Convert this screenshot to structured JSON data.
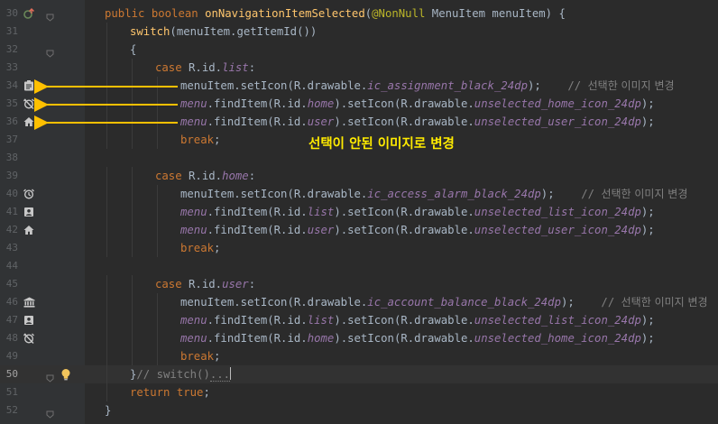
{
  "editor": {
    "annotation": "선택이 안된 이미지로 변경",
    "lines": [
      {
        "n": "30",
        "indent": 0,
        "icon": "override-icon",
        "fold": true,
        "tokens": [
          [
            "kw",
            "public "
          ],
          [
            "kw",
            "boolean "
          ],
          [
            "fn",
            "onNavigationItemSelected"
          ],
          [
            "plain",
            "("
          ],
          [
            "ann",
            "@NonNull "
          ],
          [
            "plain",
            "MenuItem menuItem) {"
          ]
        ]
      },
      {
        "n": "31",
        "indent": 1,
        "tokens": [
          [
            "fn",
            "switch"
          ],
          [
            "plain",
            "(menuItem.getItemId())"
          ]
        ]
      },
      {
        "n": "32",
        "indent": 1,
        "fold": true,
        "tokens": [
          [
            "plain",
            "{"
          ]
        ]
      },
      {
        "n": "33",
        "indent": 2,
        "tokens": [
          [
            "kw",
            "case "
          ],
          [
            "plain",
            "R.id."
          ],
          [
            "fld",
            "list"
          ],
          [
            "plain",
            ":"
          ]
        ]
      },
      {
        "n": "34",
        "indent": 3,
        "icon": "assignment-icon",
        "tokens": [
          [
            "plain",
            "menuItem.setIcon(R.drawable."
          ],
          [
            "fld",
            "ic_assignment_black_24dp"
          ],
          [
            "plain",
            ");    "
          ],
          [
            "cm",
            "// "
          ],
          [
            "cmk",
            "선택한 이미지 변경"
          ]
        ]
      },
      {
        "n": "35",
        "indent": 3,
        "icon": "alarm-off-icon",
        "tokens": [
          [
            "fld",
            "menu"
          ],
          [
            "plain",
            ".findItem(R.id."
          ],
          [
            "fld",
            "home"
          ],
          [
            "plain",
            ").setIcon(R.drawable."
          ],
          [
            "fld",
            "unselected_home_icon_24dp"
          ],
          [
            "plain",
            ");"
          ]
        ]
      },
      {
        "n": "36",
        "indent": 3,
        "icon": "home-icon",
        "tokens": [
          [
            "fld",
            "menu"
          ],
          [
            "plain",
            ".findItem(R.id."
          ],
          [
            "fld",
            "user"
          ],
          [
            "plain",
            ").setIcon(R.drawable."
          ],
          [
            "fld",
            "unselected_user_icon_24dp"
          ],
          [
            "plain",
            ");"
          ]
        ]
      },
      {
        "n": "37",
        "indent": 3,
        "tokens": [
          [
            "kw",
            "break"
          ],
          [
            "plain",
            ";"
          ]
        ]
      },
      {
        "n": "38",
        "indent": 0,
        "tokens": []
      },
      {
        "n": "39",
        "indent": 2,
        "tokens": [
          [
            "kw",
            "case "
          ],
          [
            "plain",
            "R.id."
          ],
          [
            "fld",
            "home"
          ],
          [
            "plain",
            ":"
          ]
        ]
      },
      {
        "n": "40",
        "indent": 3,
        "icon": "alarm-icon",
        "tokens": [
          [
            "plain",
            "menuItem.setIcon(R.drawable."
          ],
          [
            "fld",
            "ic_access_alarm_black_24dp"
          ],
          [
            "plain",
            ");    "
          ],
          [
            "cm",
            "// "
          ],
          [
            "cmk",
            "선택한 이미지 변경"
          ]
        ]
      },
      {
        "n": "41",
        "indent": 3,
        "icon": "account-box-icon",
        "tokens": [
          [
            "fld",
            "menu"
          ],
          [
            "plain",
            ".findItem(R.id."
          ],
          [
            "fld",
            "list"
          ],
          [
            "plain",
            ").setIcon(R.drawable."
          ],
          [
            "fld",
            "unselected_list_icon_24dp"
          ],
          [
            "plain",
            ");"
          ]
        ]
      },
      {
        "n": "42",
        "indent": 3,
        "icon": "home-icon",
        "tokens": [
          [
            "fld",
            "menu"
          ],
          [
            "plain",
            ".findItem(R.id."
          ],
          [
            "fld",
            "user"
          ],
          [
            "plain",
            ").setIcon(R.drawable."
          ],
          [
            "fld",
            "unselected_user_icon_24dp"
          ],
          [
            "plain",
            ");"
          ]
        ]
      },
      {
        "n": "43",
        "indent": 3,
        "tokens": [
          [
            "kw",
            "break"
          ],
          [
            "plain",
            ";"
          ]
        ]
      },
      {
        "n": "44",
        "indent": 0,
        "tokens": []
      },
      {
        "n": "45",
        "indent": 2,
        "tokens": [
          [
            "kw",
            "case "
          ],
          [
            "plain",
            "R.id."
          ],
          [
            "fld",
            "user"
          ],
          [
            "plain",
            ":"
          ]
        ]
      },
      {
        "n": "46",
        "indent": 3,
        "icon": "bank-icon",
        "tokens": [
          [
            "plain",
            "menuItem.setIcon(R.drawable."
          ],
          [
            "fld",
            "ic_account_balance_black_24dp"
          ],
          [
            "plain",
            ");    "
          ],
          [
            "cm",
            "// "
          ],
          [
            "cmk",
            "선택한 이미지 변경"
          ]
        ]
      },
      {
        "n": "47",
        "indent": 3,
        "icon": "account-box-icon",
        "tokens": [
          [
            "fld",
            "menu"
          ],
          [
            "plain",
            ".findItem(R.id."
          ],
          [
            "fld",
            "list"
          ],
          [
            "plain",
            ").setIcon(R.drawable."
          ],
          [
            "fld",
            "unselected_list_icon_24dp"
          ],
          [
            "plain",
            ");"
          ]
        ]
      },
      {
        "n": "48",
        "indent": 3,
        "icon": "alarm-off-icon",
        "tokens": [
          [
            "fld",
            "menu"
          ],
          [
            "plain",
            ".findItem(R.id."
          ],
          [
            "fld",
            "home"
          ],
          [
            "plain",
            ").setIcon(R.drawable."
          ],
          [
            "fld",
            "unselected_home_icon_24dp"
          ],
          [
            "plain",
            ");"
          ]
        ]
      },
      {
        "n": "49",
        "indent": 3,
        "tokens": [
          [
            "kw",
            "break"
          ],
          [
            "plain",
            ";"
          ]
        ]
      },
      {
        "n": "50",
        "indent": 1,
        "current": true,
        "bulb": true,
        "fold": true,
        "tokens": [
          [
            "plain",
            "}"
          ],
          [
            "cm",
            "// switch()"
          ],
          [
            "cm",
            "..."
          ],
          [
            "caret",
            ""
          ]
        ]
      },
      {
        "n": "51",
        "indent": 1,
        "tokens": [
          [
            "kw",
            "return "
          ],
          [
            "kw",
            "true"
          ],
          [
            "plain",
            ";"
          ]
        ]
      },
      {
        "n": "52",
        "indent": 0,
        "fold": true,
        "tokens": [
          [
            "plain",
            "}"
          ]
        ]
      }
    ]
  },
  "colors": {
    "background": "#2b2b2b",
    "gutter": "#313335",
    "arrow": "#ffc000",
    "annotation_text": "#ffeb00"
  }
}
